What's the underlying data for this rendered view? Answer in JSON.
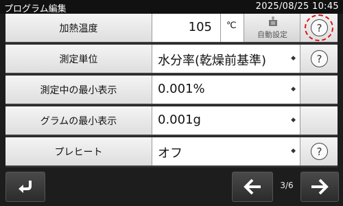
{
  "header": {
    "title": "プログラム編集",
    "datetime": "2025/08/25  10:45"
  },
  "rows": [
    {
      "label": "加熱温度",
      "value": "105",
      "unit": "℃",
      "auto_label": "自動設定",
      "help": "?"
    },
    {
      "label": "測定単位",
      "value": "水分率(乾燥前基準)",
      "dropdown": "◆",
      "help": "?"
    },
    {
      "label": "測定中の最小表示",
      "value": "0.001%",
      "dropdown": "◆"
    },
    {
      "label": "グラムの最小表示",
      "value": "0.001g",
      "dropdown": "◆"
    },
    {
      "label": "プレヒート",
      "value": "オフ",
      "dropdown": "◆",
      "help": "?"
    }
  ],
  "footer": {
    "page": "3/6"
  },
  "icons": {
    "back": "return-arrow-icon",
    "prev": "left-arrow-icon",
    "next": "right-arrow-icon",
    "auto": "auto-setting-icon",
    "help": "question-mark-icon"
  },
  "colors": {
    "highlight_ring": "#dd1111",
    "screen_bg": "#1d1d1d"
  }
}
